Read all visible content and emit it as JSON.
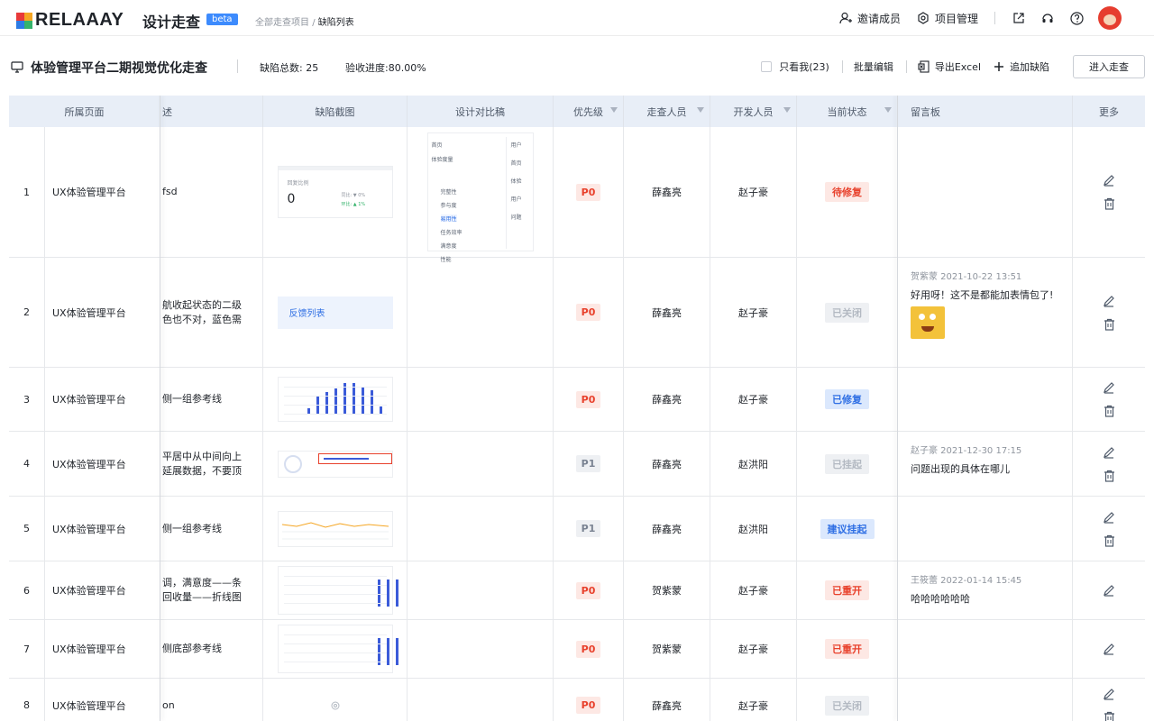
{
  "topbar": {
    "logo_text": "RELAAAY",
    "app_title": "设计走查",
    "beta_label": "beta",
    "breadcrumb_root": "全部走查项目",
    "breadcrumb_sep": "/",
    "breadcrumb_current": "缺陷列表",
    "invite_label": "邀请成员",
    "project_mgmt_label": "项目管理"
  },
  "project": {
    "name": "体验管理平台二期视觉优化走查",
    "total_label": "缺陷总数:",
    "total_value": "25",
    "progress_label": "验收进度:",
    "progress_value": "80.00%",
    "only_me_label": "只看我(23)",
    "batch_edit_label": "批量编辑",
    "export_label": "导出Excel",
    "add_defect_label": "追加缺陷",
    "enter_label": "进入走查"
  },
  "table": {
    "headers": {
      "page": "所属页面",
      "desc": "述",
      "shot": "缺陷截图",
      "design": "设计对比稿",
      "priority": "优先级",
      "walker": "走查人员",
      "developer": "开发人员",
      "state": "当前状态",
      "message": "留言板",
      "more": "更多"
    },
    "rows": [
      {
        "num": "1",
        "page": "UX体验管理平台",
        "desc": [
          "fsd"
        ],
        "priority": "P0",
        "walker": "薛鑫亮",
        "developer": "赵子豪",
        "state": "待修复",
        "state_kind": "todo",
        "shot": "card",
        "design": true,
        "msg": null,
        "actions": 2
      },
      {
        "num": "2",
        "page": "UX体验管理平台",
        "desc": [
          "航收起状态的二级",
          "色也不对，蓝色需"
        ],
        "priority": "P0",
        "walker": "薛鑫亮",
        "developer": "赵子豪",
        "state": "已关闭",
        "state_kind": "closed",
        "shot": "blue",
        "shot_text": "反馈列表",
        "design": false,
        "msg": {
          "meta": "贺紫蒙  2021-10-22 13:51",
          "text": "好用呀！这不是都能加表情包了!",
          "sticker": true
        },
        "actions": 2
      },
      {
        "num": "3",
        "page": "UX体验管理平台",
        "desc": [
          "侧一组参考线"
        ],
        "priority": "P0",
        "walker": "薛鑫亮",
        "developer": "赵子豪",
        "state": "已修复",
        "state_kind": "fixed",
        "shot": "bars",
        "design": false,
        "msg": null,
        "actions": 2
      },
      {
        "num": "4",
        "page": "UX体验管理平台",
        "desc": [
          "平居中从中间向上",
          "延展数据，不要顶"
        ],
        "priority": "P1",
        "walker": "薛鑫亮",
        "developer": "赵洪阳",
        "state": "已挂起",
        "state_kind": "hold",
        "shot": "mixed",
        "design": false,
        "msg": {
          "meta": "赵子豪  2021-12-30 17:15",
          "text": "问题出现的具体在哪儿",
          "sticker": false
        },
        "actions": 2
      },
      {
        "num": "5",
        "page": "UX体验管理平台",
        "desc": [
          "侧一组参考线"
        ],
        "priority": "P1",
        "walker": "薛鑫亮",
        "developer": "赵洪阳",
        "state": "建议挂起",
        "state_kind": "suggest",
        "shot": "line",
        "design": false,
        "msg": null,
        "actions": 2
      },
      {
        "num": "6",
        "page": "UX体验管理平台",
        "desc": [
          "调，满意度——条",
          "回收量——折线图"
        ],
        "priority": "P0",
        "walker": "贺紫蒙",
        "developer": "赵子豪",
        "state": "已重开",
        "state_kind": "reopen",
        "shot": "bars2",
        "design": false,
        "msg": {
          "meta": "王筱蕾  2022-01-14 15:45",
          "text": "哈哈哈哈哈哈",
          "sticker": false
        },
        "actions": 1
      },
      {
        "num": "7",
        "page": "UX体验管理平台",
        "desc": [
          "侧底部参考线"
        ],
        "priority": "P0",
        "walker": "贺紫蒙",
        "developer": "赵子豪",
        "state": "已重开",
        "state_kind": "reopen",
        "shot": "bars2",
        "design": false,
        "msg": null,
        "actions": 1
      },
      {
        "num": "8",
        "page": "UX体验管理平台",
        "desc": [
          "on"
        ],
        "priority": "P0",
        "walker": "薛鑫亮",
        "developer": "赵子豪",
        "state": "已关闭",
        "state_kind": "closed",
        "shot": "gear",
        "design": false,
        "msg": null,
        "actions": 2
      }
    ]
  },
  "shot_card": {
    "label": "回复比例",
    "value": "0",
    "stat1_label": "同比:",
    "stat1_value": "0%",
    "stat2_label": "环比:",
    "stat2_value": "1%"
  },
  "design_menu": {
    "items": [
      "首页",
      "体验度量",
      "完整性",
      "参与度",
      "易用性",
      "任务效率",
      "满意度",
      "性能"
    ],
    "right_items": [
      "用户",
      "首页",
      "体验",
      "用户",
      "问题"
    ]
  },
  "colors": {
    "accent": "#2f6fe4",
    "danger": "#e8412c",
    "header_bg": "#e8eef7"
  }
}
